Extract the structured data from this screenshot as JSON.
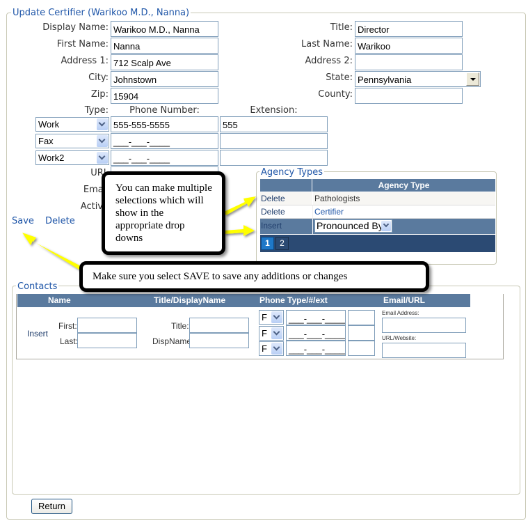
{
  "certifier": {
    "legend": "Update Certifier (Warikoo M.D., Nanna)",
    "fields": {
      "display_name": {
        "label": "Display Name:",
        "value": "Warikoo M.D., Nanna"
      },
      "first_name": {
        "label": "First Name:",
        "value": "Nanna"
      },
      "address1": {
        "label": "Address 1:",
        "value": "712 Scalp Ave"
      },
      "city": {
        "label": "City:",
        "value": "Johnstown"
      },
      "zip": {
        "label": "Zip:",
        "value": "15904"
      },
      "title": {
        "label": "Title:",
        "value": "Director"
      },
      "last_name": {
        "label": "Last Name:",
        "value": "Warikoo"
      },
      "address2": {
        "label": "Address 2:",
        "value": ""
      },
      "state": {
        "label": "State:",
        "value": "Pennsylvania"
      },
      "county": {
        "label": "County:",
        "value": ""
      }
    },
    "phones": {
      "headers": {
        "type": "Type:",
        "number": "Phone Number:",
        "extension": "Extension:"
      },
      "rows": [
        {
          "type": "Work",
          "number": "555-555-5555",
          "extension": "555"
        },
        {
          "type": "Fax",
          "number": "___-___-____",
          "extension": ""
        },
        {
          "type": "Work2",
          "number": "___-___-____",
          "extension": ""
        }
      ]
    },
    "url_label": "URL",
    "email_label": "Email",
    "active_label": "Active",
    "save_label": "Save",
    "delete_label": "Delete"
  },
  "agency_types": {
    "legend": "Agency Types",
    "column_header": "Agency Type",
    "rows": [
      {
        "action": "Delete",
        "value": "Pathologists"
      },
      {
        "action": "Delete",
        "value": "Certifier"
      }
    ],
    "insert": {
      "action": "Insert",
      "selected": "Pronounced By"
    },
    "pages": [
      "1",
      "2"
    ],
    "current_page": "1"
  },
  "contacts": {
    "legend": "Contacts",
    "headers": [
      "Name",
      "Title/DisplayName",
      "Phone Type/#/ext",
      "Email/URL"
    ],
    "insert_label": "Insert",
    "first_label": "First:",
    "last_label": "Last:",
    "title_label": "Title:",
    "dispname_label": "DispName:",
    "phone_rows": [
      {
        "type": "F",
        "number": "___-___-____",
        "ext": ""
      },
      {
        "type": "F",
        "number": "___-___-____",
        "ext": ""
      },
      {
        "type": "F",
        "number": "___-___-____",
        "ext": ""
      }
    ],
    "email_label": "Email Address:",
    "url_label": "URL/Website:"
  },
  "return_button": "Return",
  "callouts": {
    "multiple": "You can make multiple selections which will show in the appropriate drop downs",
    "save": "Make sure you select SAVE to save any additions or changes"
  },
  "colors": {
    "accent": "#1f56a8",
    "grid_header": "#5a7a9e",
    "pager": "#2b4a73",
    "arrow": "#ffff00"
  }
}
